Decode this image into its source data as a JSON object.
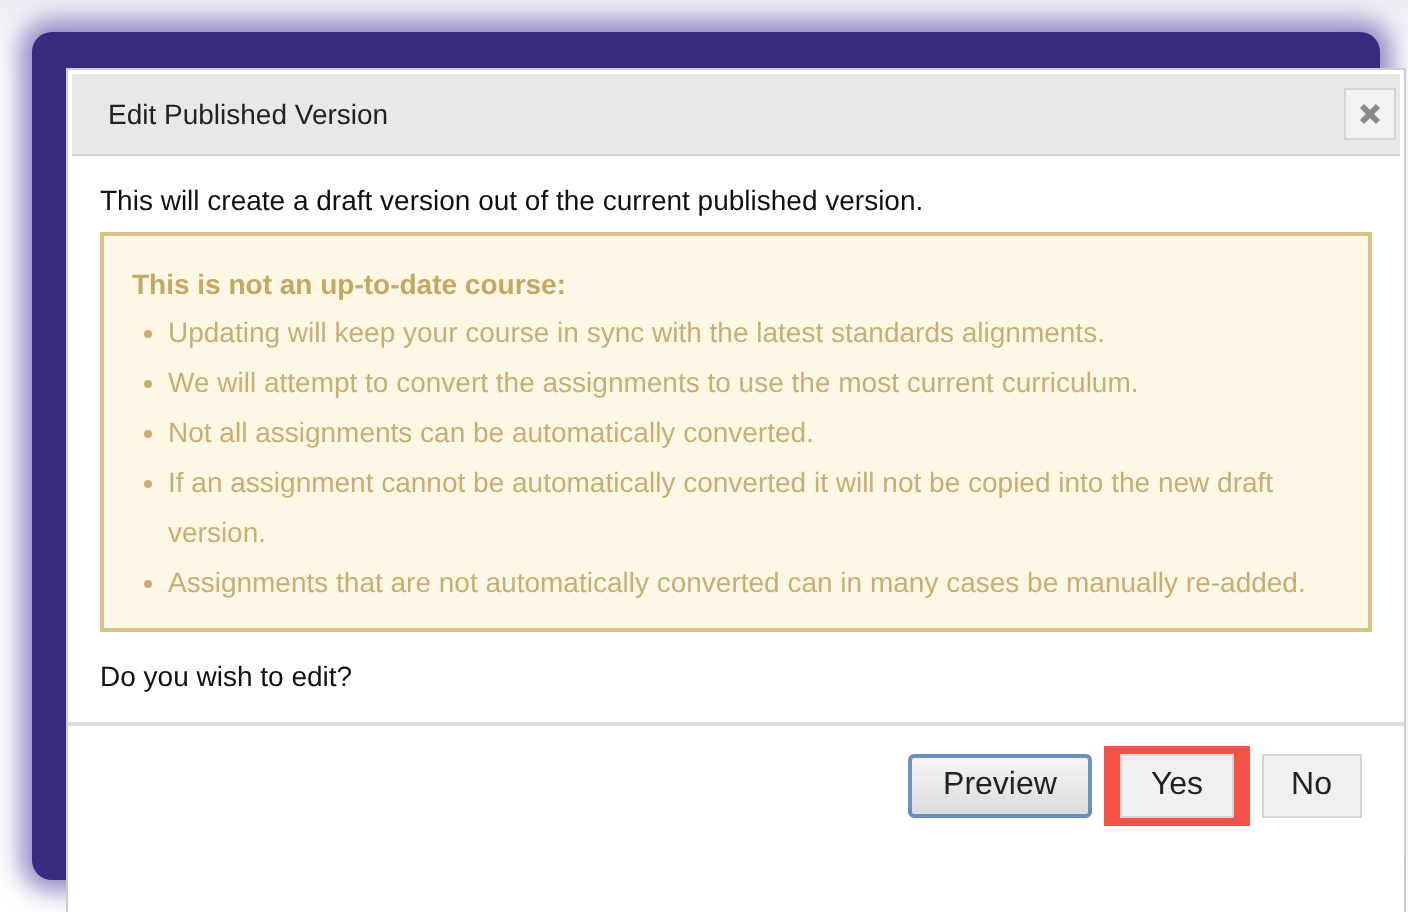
{
  "dialog": {
    "title": "Edit Published Version",
    "intro": "This will create a draft version out of the current published version.",
    "warning": {
      "heading": "This is not an up-to-date course:",
      "items": [
        "Updating will keep your course in sync with the latest standards alignments.",
        "We will attempt to convert the assignments to use the most current curriculum.",
        "Not all assignments can be automatically converted.",
        "If an assignment cannot be automatically converted it will not be copied into the new draft version.",
        "Assignments that are not automatically converted can in many cases be manually re-added."
      ]
    },
    "question": "Do you wish to edit?",
    "buttons": [
      {
        "label": "Preview",
        "focused": true,
        "highlighted": false
      },
      {
        "label": "Yes",
        "focused": false,
        "highlighted": true
      },
      {
        "label": "No",
        "focused": false,
        "highlighted": false
      }
    ]
  }
}
